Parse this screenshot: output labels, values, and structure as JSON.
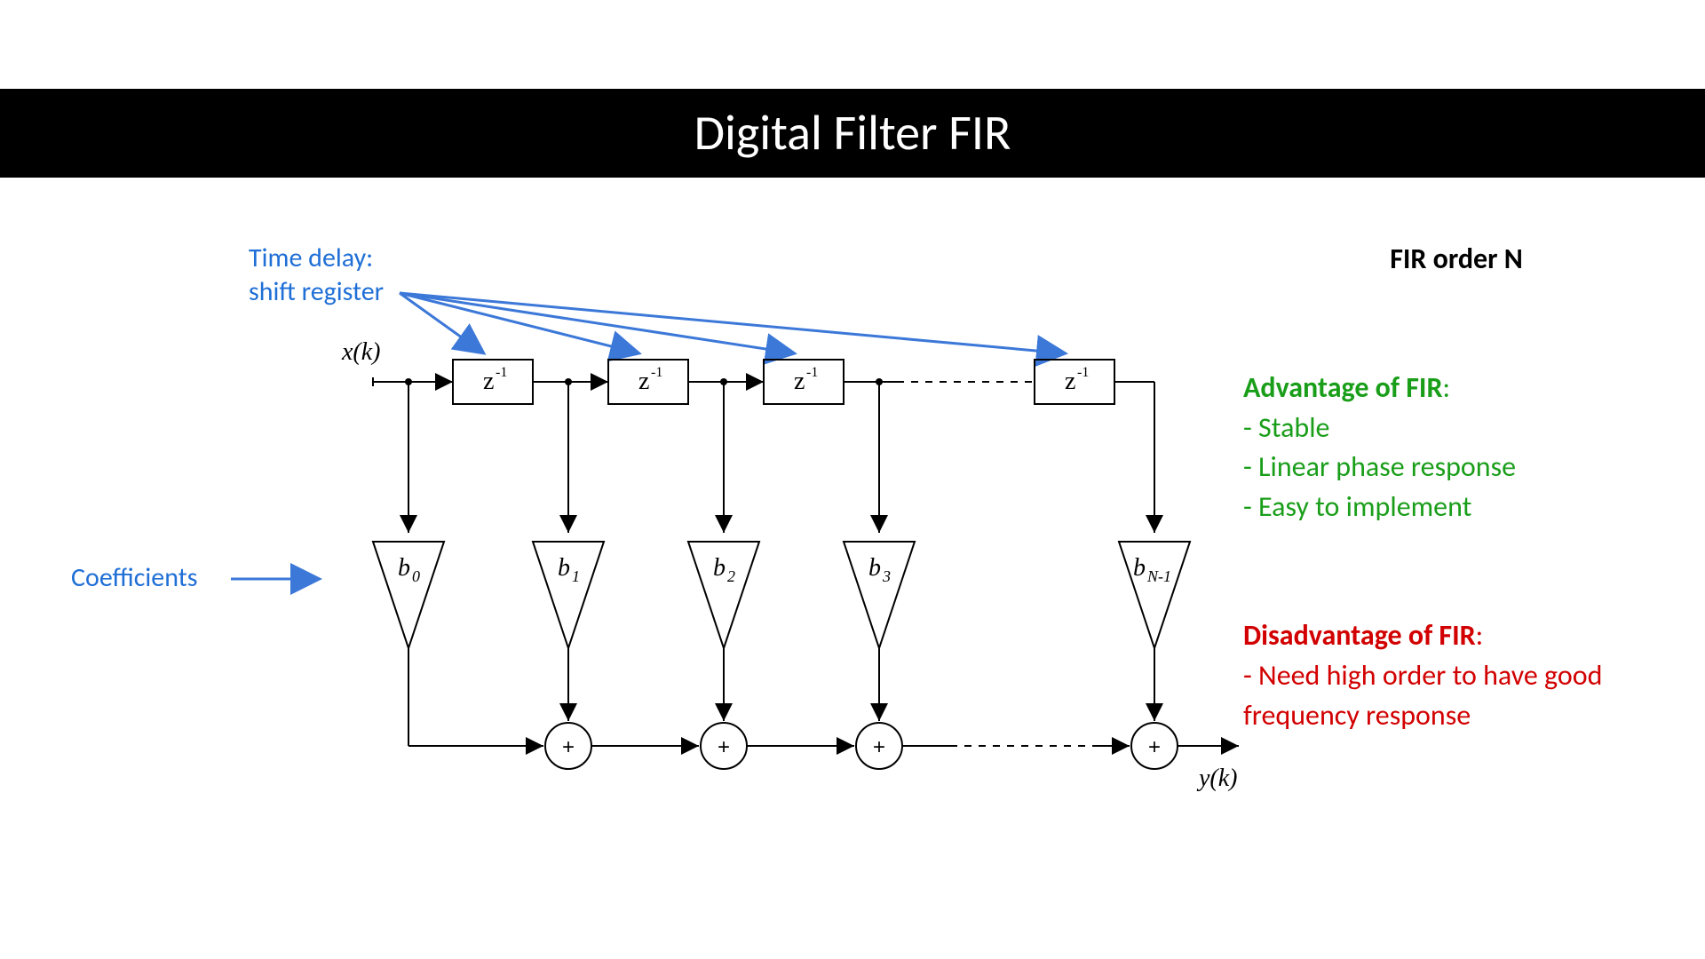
{
  "title": "Digital Filter FIR",
  "order_label": "FIR order N",
  "advantage": {
    "heading": "Advantage of FIR",
    "items": [
      "- Stable",
      "- Linear phase response",
      "- Easy to implement"
    ]
  },
  "disadvantage": {
    "heading": "Disadvantage of FIR",
    "items": [
      "- Need high order to have good frequency response"
    ]
  },
  "annotations": {
    "time_delay_line1": "Time delay:",
    "time_delay_line2": "shift register",
    "coefficients": "Coefficients"
  },
  "diagram": {
    "input_label": "x(k)",
    "output_label": "y(k)",
    "delay_label": "z",
    "delay_sup": "-1",
    "coeff_labels": [
      "b",
      "b",
      "b",
      "b",
      "b"
    ],
    "coeff_subs": [
      "0",
      "1",
      "2",
      "3",
      "N-1"
    ],
    "sum_label": "+"
  }
}
